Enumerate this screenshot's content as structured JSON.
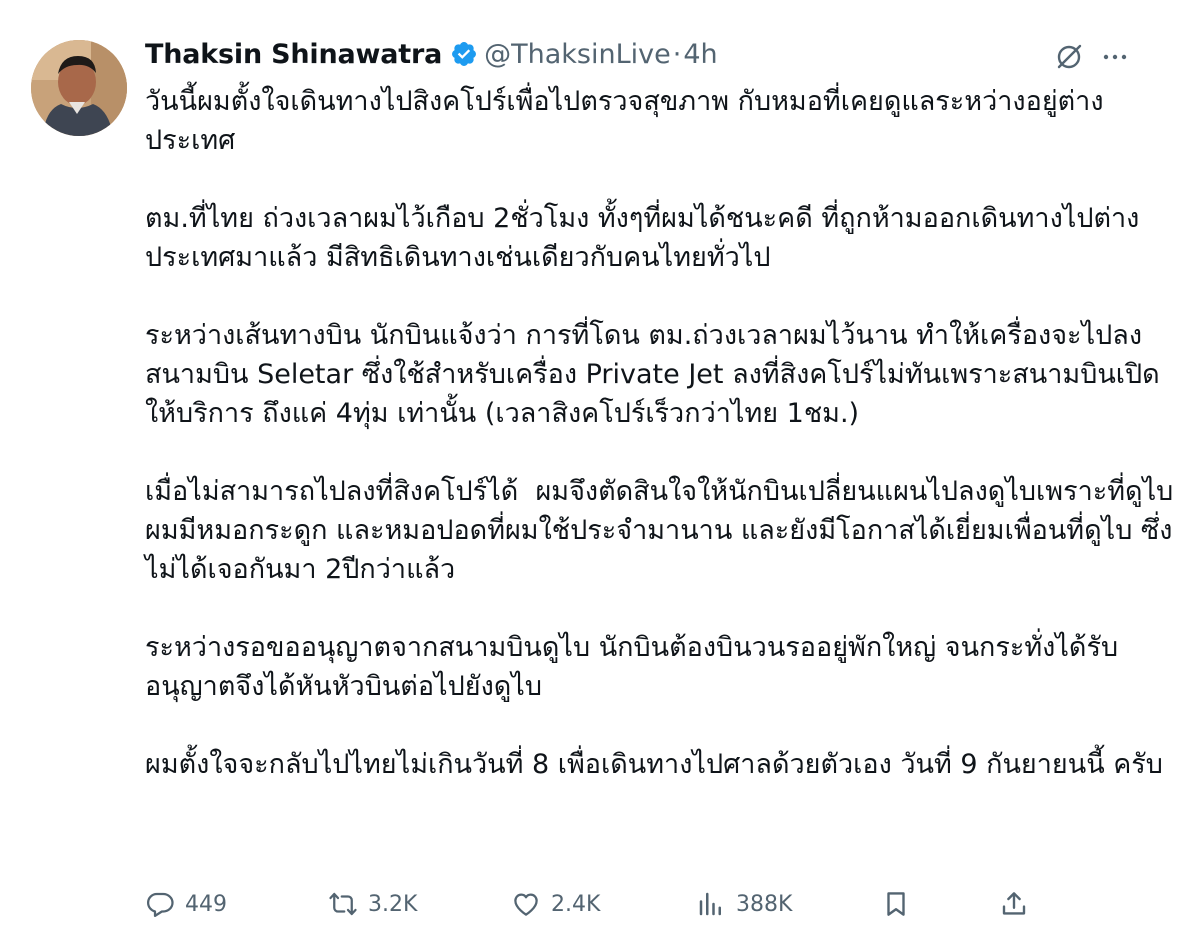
{
  "author": {
    "display_name": "Thaksin Shinawatra",
    "handle": "@ThaksinLive",
    "separator": "·",
    "time": "4h",
    "verified": true
  },
  "icons": {
    "avatar": "profile-photo",
    "verified": "verified-badge-icon",
    "grok": "grok-icon",
    "more": "more-horizontal-icon"
  },
  "colors": {
    "verified_blue": "#1d9bf0",
    "text": "#0f1419",
    "secondary": "#536471"
  },
  "tweet": {
    "paragraphs": [
      "วันนี้ผมตั้งใจเดินทางไปสิงคโปร์เพื่อไปตรวจสุขภาพ กับหมอที่เคยดูแลระหว่างอยู่ต่างประเทศ",
      "ตม.ที่ไทย ถ่วงเวลาผมไว้เกือบ 2ชั่วโมง ทั้งๆที่ผมได้ชนะคดี ที่ถูกห้ามออกเดินทางไปต่างประเทศมาแล้ว มีสิทธิเดินทางเช่นเดียวกับคนไทยทั่วไป",
      "ระหว่างเส้นทางบิน นักบินแจ้งว่า การที่โดน ตม.ถ่วงเวลาผมไว้นาน ทำให้เครื่องจะไปลงสนามบิน Seletar ซึ่งใช้สำหรับเครื่อง Private Jet ลงที่สิงคโปร์ไม่ทันเพราะสนามบินเปิดให้บริการ ถึงแค่ 4ทุ่ม เท่านั้น (เวลาสิงคโปร์เร็วกว่าไทย 1ชม.)",
      "เมื่อไม่สามารถไปลงที่สิงคโปร์ได้  ผมจึงตัดสินใจให้นักบินเปลี่ยนแผนไปลงดูไบเพราะที่ดูไบผมมีหมอกระดูก และหมอปอดที่ผมใช้ประจำมานาน และยังมีโอกาสได้เยี่ยมเพื่อนที่ดูไบ ซึ่งไม่ได้เจอกันมา 2ปีกว่าแล้ว",
      "ระหว่างรอขออนุญาตจากสนามบินดูไบ นักบินต้องบินวนรออยู่พักใหญ่ จนกระทั่งได้รับอนุญาตจึงได้หันหัวบินต่อไปยังดูไบ",
      "ผมตั้งใจจะกลับไปไทยไม่เกินวันที่ 8 เพื่อเดินทางไปศาลด้วยตัวเอง วันที่ 9 กันยายนนี้ ครับ"
    ]
  },
  "actions": {
    "reply": {
      "icon": "reply-icon",
      "count": "449"
    },
    "repost": {
      "icon": "repost-icon",
      "count": "3.2K"
    },
    "like": {
      "icon": "like-icon",
      "count": "2.4K"
    },
    "views": {
      "icon": "views-icon",
      "count": "388K"
    },
    "bookmark": {
      "icon": "bookmark-icon"
    },
    "share": {
      "icon": "share-icon"
    }
  }
}
